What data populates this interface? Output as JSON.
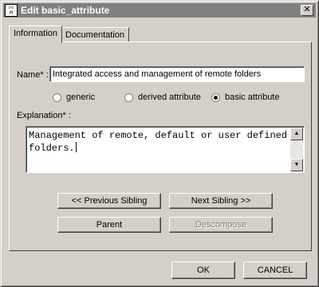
{
  "window": {
    "title": "Edit basic_attribute",
    "close_glyph": "✕",
    "icon": "app-icon"
  },
  "tabs": [
    {
      "label": "Information",
      "active": true
    },
    {
      "label": "Documentation",
      "active": false
    }
  ],
  "form": {
    "name_label": "Name* :",
    "name_value": "Integrated access and management of remote folders",
    "radios": [
      {
        "label": "generic",
        "checked": false
      },
      {
        "label": "derived attribute",
        "checked": false
      },
      {
        "label": "basic attribute",
        "checked": true
      }
    ],
    "explanation_label": "Explanation* :",
    "explanation_value": "Management of remote, default or user defined\nfolders."
  },
  "buttons": {
    "previous_sibling": "<< Previous Sibling",
    "next_sibling": "Next Sibling >>",
    "parent": "Parent",
    "descompose": "Descompose",
    "ok": "OK",
    "cancel": "CANCEL"
  }
}
